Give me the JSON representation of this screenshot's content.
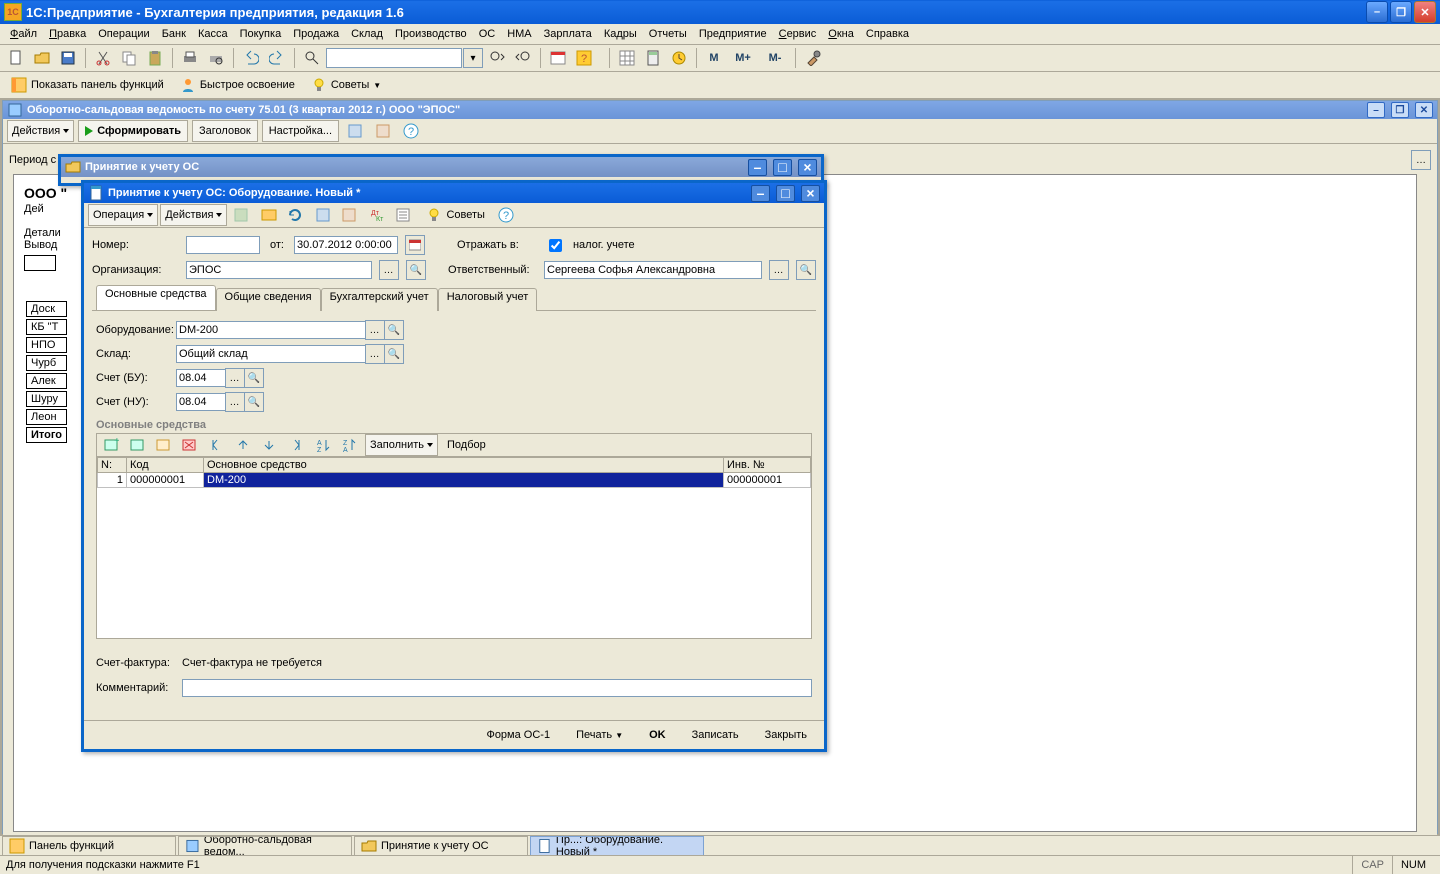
{
  "app": {
    "title": "1С:Предприятие  - Бухгалтерия предприятия, редакция 1.6"
  },
  "menu": {
    "file": "Файл",
    "edit": "Правка",
    "operations": "Операции",
    "bank": "Банк",
    "cash": "Касса",
    "purchase": "Покупка",
    "sale": "Продажа",
    "warehouse": "Склад",
    "production": "Производство",
    "os": "ОС",
    "nma": "НМА",
    "salary": "Зарплата",
    "kadry": "Кадры",
    "reports": "Отчеты",
    "enterprise": "Предприятие",
    "service": "Сервис",
    "windows": "Окна",
    "help": "Справка"
  },
  "toolbar1": {
    "mlabel": "М",
    "mplus": "М+",
    "mminus": "М-"
  },
  "toolbar2": {
    "show_panel": "Показать панель функций",
    "fast_learn": "Быстрое освоение",
    "tips": "Советы"
  },
  "report_child": {
    "title": "Оборотно-сальдовая ведомость по счету 75.01 (3 квартал 2012 г.) ООО \"ЭПОС\"",
    "actions": "Действия",
    "form": "Сформировать",
    "header": "Заголовок",
    "settings": "Настройка...",
    "period_label": "Период с",
    "org_prefix": "ООО \"",
    "deis": "Дей",
    "detal": "Детали",
    "vyvod": "Вывод",
    "rows": [
      "Доск",
      "КБ \"Т",
      "НПО",
      "Чурб",
      "Алек",
      "Шуру",
      "Леон",
      "Итого"
    ]
  },
  "outer_win": {
    "title": "Принятие к учету ОС"
  },
  "inner_win": {
    "title": "Принятие к учету ОС: Оборудование. Новый *",
    "operation": "Операция",
    "actions": "Действия",
    "tips": "Советы",
    "number_label": "Номер:",
    "number": "",
    "from_label": "от:",
    "date": "30.07.2012 0:00:00",
    "reflect_label": "Отражать в:",
    "tax_cb": "налог. учете",
    "org_label": "Организация:",
    "org": "ЭПОС",
    "resp_label": "Ответственный:",
    "resp": "Сергеева Софья Александровна",
    "tabs": [
      "Основные средства",
      "Общие сведения",
      "Бухгалтерский учет",
      "Налоговый учет"
    ],
    "equipment_label": "Оборудование:",
    "equipment": "DM-200",
    "warehouse_label": "Склад:",
    "warehouse": "Общий склад",
    "acc_bu_label": "Счет (БУ):",
    "acc_bu": "08.04",
    "acc_nu_label": "Счет (НУ):",
    "acc_nu": "08.04",
    "section": "Основные средства",
    "grid_actions": {
      "fill": "Заполнить",
      "select": "Подбор"
    },
    "grid": {
      "cols": [
        "N:",
        "Код",
        "Основное средство",
        "Инв. №"
      ],
      "row": {
        "n": "1",
        "code": "000000001",
        "name": "DM-200",
        "inv": "000000001"
      }
    },
    "invoice_label": "Счет-фактура:",
    "invoice": "Счет-фактура не требуется",
    "comment_label": "Комментарий:",
    "comment": "",
    "bottom": {
      "form_os1": "Форма ОС-1",
      "print": "Печать",
      "ok": "OK",
      "save": "Записать",
      "close": "Закрыть"
    }
  },
  "taskbar": {
    "panel": "Панель функций",
    "report": "Оборотно-сальдовая ведом...",
    "outer": "Принятие к учету ОС",
    "inner": "Пр...: Оборудование. Новый *"
  },
  "status": {
    "hint": "Для получения подсказки нажмите F1",
    "cap": "CAP",
    "num": "NUM"
  }
}
